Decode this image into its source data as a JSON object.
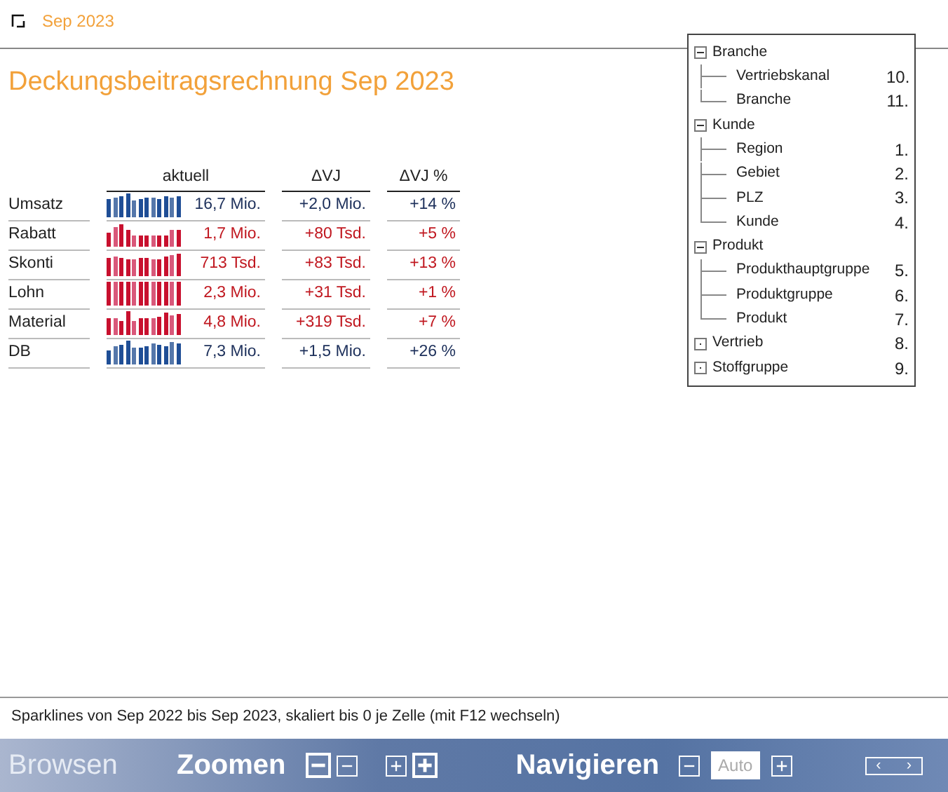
{
  "header": {
    "period": "Sep 2023"
  },
  "title": "Deckungsbeitragsrechnung Sep 2023",
  "table": {
    "columns": [
      "aktuell",
      "ΔVJ",
      "ΔVJ %"
    ],
    "rows": [
      {
        "label": "Umsatz",
        "kind": "revenue",
        "value": "16,7 Mio.",
        "delta": "+2,0 Mio.",
        "delta_pct": "+14 %"
      },
      {
        "label": "Rabatt",
        "kind": "cost",
        "value": "1,7 Mio.",
        "delta": "+80 Tsd.",
        "delta_pct": "+5 %"
      },
      {
        "label": "Skonti",
        "kind": "cost",
        "value": "713 Tsd.",
        "delta": "+83 Tsd.",
        "delta_pct": "+13 %"
      },
      {
        "label": "Lohn",
        "kind": "cost",
        "value": "2,3 Mio.",
        "delta": "+31 Tsd.",
        "delta_pct": "+1 %"
      },
      {
        "label": "Material",
        "kind": "cost",
        "value": "4,8 Mio.",
        "delta": "+319 Tsd.",
        "delta_pct": "+7 %"
      },
      {
        "label": "DB",
        "kind": "revenue",
        "value": "7,3 Mio.",
        "delta": "+1,5 Mio.",
        "delta_pct": "+26 %"
      }
    ]
  },
  "tree": [
    {
      "label": "Branche",
      "expanded": true,
      "children": [
        {
          "label": "Vertriebskanal",
          "number": "10."
        },
        {
          "label": "Branche",
          "number": "11."
        }
      ]
    },
    {
      "label": "Kunde",
      "expanded": true,
      "children": [
        {
          "label": "Region",
          "number": "1."
        },
        {
          "label": "Gebiet",
          "number": "2."
        },
        {
          "label": "PLZ",
          "number": "3."
        },
        {
          "label": "Kunde",
          "number": "4."
        }
      ]
    },
    {
      "label": "Produkt",
      "expanded": true,
      "children": [
        {
          "label": "Produkthauptgruppe",
          "number": "5."
        },
        {
          "label": "Produktgruppe",
          "number": "6."
        },
        {
          "label": "Produkt",
          "number": "7."
        }
      ]
    },
    {
      "label": "Vertrieb",
      "expanded": false,
      "number": "8."
    },
    {
      "label": "Stoffgruppe",
      "expanded": false,
      "number": "9."
    }
  ],
  "footnote": "Sparklines von Sep 2022 bis Sep 2023, skaliert bis 0 je Zelle (mit F12 wechseln)",
  "toolbar": {
    "browse": "Browsen",
    "zoom": "Zoomen",
    "navigate": "Navigieren",
    "auto": "Auto",
    "prev": "‹",
    "next": "›"
  }
}
